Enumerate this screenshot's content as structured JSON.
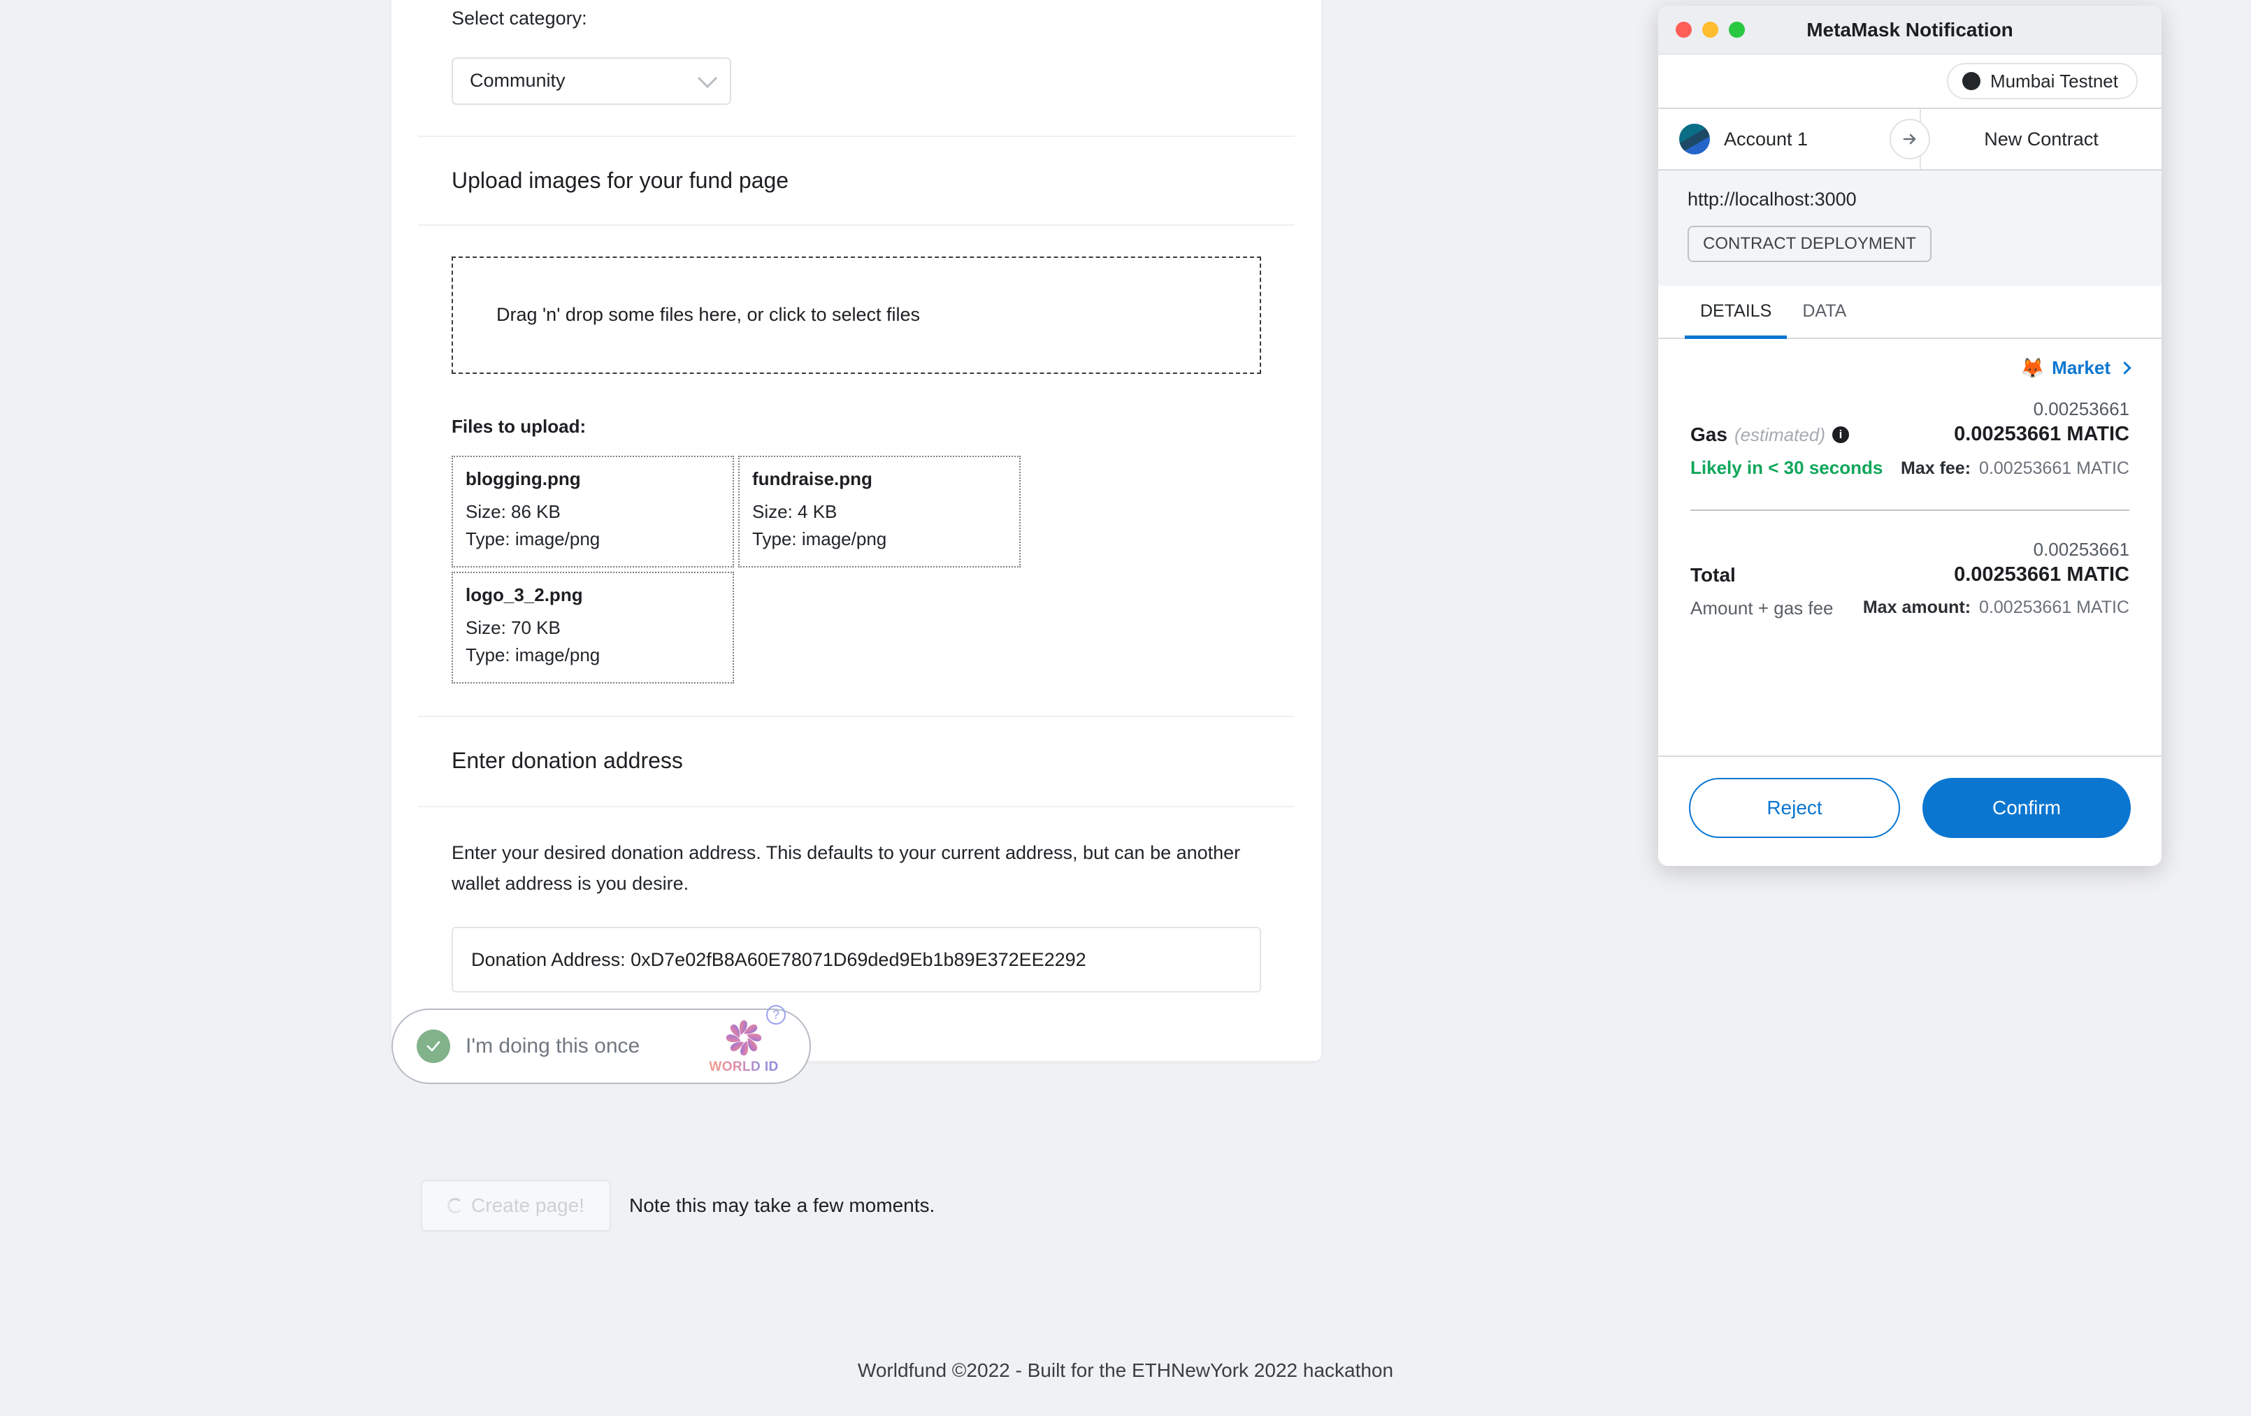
{
  "form": {
    "category": {
      "label": "Select category:",
      "value": "Community",
      "chevron_icon": "chevron-down-icon"
    },
    "upload": {
      "section_title": "Upload images for your fund page",
      "dropzone_text": "Drag 'n' drop some files here, or click to select files",
      "files_label": "Files to upload:",
      "files": [
        {
          "name": "blogging.png",
          "size": "Size: 86 KB",
          "type": "Type: image/png"
        },
        {
          "name": "fundraise.png",
          "size": "Size: 4 KB",
          "type": "Type: image/png"
        },
        {
          "name": "logo_3_2.png",
          "size": "Size: 70 KB",
          "type": "Type: image/png"
        }
      ]
    },
    "donation": {
      "section_title": "Enter donation address",
      "description": "Enter your desired donation address. This defaults to your current address, but can be another wallet address is you desire.",
      "address_value": "Donation Address: 0xD7e02fB8A60E78071D69ded9Eb1b89E372EE2292"
    },
    "worldid": {
      "text": "I'm doing this once",
      "wordmark": "WORLD ID",
      "help_badge": "?",
      "check_icon": "check-circle-icon",
      "logo_icon": "world-id-logo-icon"
    },
    "submit": {
      "button_label": "Create page!",
      "spinner_icon": "spinner-icon",
      "note": "Note this may take a few moments."
    }
  },
  "footer": {
    "text": "Worldfund ©2022 - Built for the ETHNewYork 2022 hackathon"
  },
  "metamask": {
    "window_title": "MetaMask Notification",
    "traffic_lights": [
      "close-icon",
      "minimize-icon",
      "zoom-icon"
    ],
    "network": {
      "name": "Mumbai Testnet",
      "dot_color": "#24272a"
    },
    "accounts": {
      "from": "Account 1",
      "to": "New Contract",
      "avatar_icon": "account-blockie-avatar",
      "arrow_icon": "arrow-right-icon"
    },
    "origin": {
      "url": "http://localhost:3000",
      "tag": "CONTRACT DEPLOYMENT"
    },
    "tabs": [
      {
        "label": "DETAILS",
        "active": true
      },
      {
        "label": "DATA",
        "active": false
      }
    ],
    "market": {
      "fox_icon": "fox-emoji-icon",
      "label": "Market",
      "chevron_icon": "chevron-right-icon"
    },
    "gas": {
      "key": "Gas",
      "key_sub": "(estimated)",
      "info_icon": "info-icon",
      "fiat": "0.00253661",
      "amount": "0.00253661 MATIC",
      "likely": "Likely in < 30 seconds",
      "max_fee_label": "Max fee:",
      "max_fee_value": "0.00253661 MATIC"
    },
    "total": {
      "key": "Total",
      "fiat": "0.00253661",
      "amount": "0.00253661 MATIC",
      "note": "Amount + gas fee",
      "max_amount_label": "Max amount:",
      "max_amount_value": "0.00253661 MATIC"
    },
    "actions": {
      "reject": "Reject",
      "confirm": "Confirm"
    },
    "colors": {
      "accent_blue": "#0b76d0",
      "success_green": "#10a65a"
    }
  }
}
